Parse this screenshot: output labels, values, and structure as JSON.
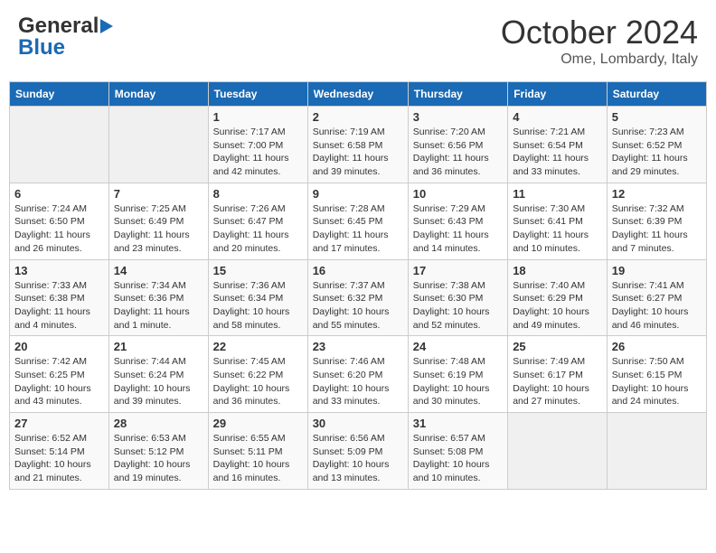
{
  "header": {
    "logo_line1": "General",
    "logo_line2": "Blue",
    "month": "October 2024",
    "location": "Ome, Lombardy, Italy"
  },
  "weekdays": [
    "Sunday",
    "Monday",
    "Tuesday",
    "Wednesday",
    "Thursday",
    "Friday",
    "Saturday"
  ],
  "weeks": [
    [
      {
        "day": "",
        "sunrise": "",
        "sunset": "",
        "daylight": ""
      },
      {
        "day": "",
        "sunrise": "",
        "sunset": "",
        "daylight": ""
      },
      {
        "day": "1",
        "sunrise": "Sunrise: 7:17 AM",
        "sunset": "Sunset: 7:00 PM",
        "daylight": "Daylight: 11 hours and 42 minutes."
      },
      {
        "day": "2",
        "sunrise": "Sunrise: 7:19 AM",
        "sunset": "Sunset: 6:58 PM",
        "daylight": "Daylight: 11 hours and 39 minutes."
      },
      {
        "day": "3",
        "sunrise": "Sunrise: 7:20 AM",
        "sunset": "Sunset: 6:56 PM",
        "daylight": "Daylight: 11 hours and 36 minutes."
      },
      {
        "day": "4",
        "sunrise": "Sunrise: 7:21 AM",
        "sunset": "Sunset: 6:54 PM",
        "daylight": "Daylight: 11 hours and 33 minutes."
      },
      {
        "day": "5",
        "sunrise": "Sunrise: 7:23 AM",
        "sunset": "Sunset: 6:52 PM",
        "daylight": "Daylight: 11 hours and 29 minutes."
      }
    ],
    [
      {
        "day": "6",
        "sunrise": "Sunrise: 7:24 AM",
        "sunset": "Sunset: 6:50 PM",
        "daylight": "Daylight: 11 hours and 26 minutes."
      },
      {
        "day": "7",
        "sunrise": "Sunrise: 7:25 AM",
        "sunset": "Sunset: 6:49 PM",
        "daylight": "Daylight: 11 hours and 23 minutes."
      },
      {
        "day": "8",
        "sunrise": "Sunrise: 7:26 AM",
        "sunset": "Sunset: 6:47 PM",
        "daylight": "Daylight: 11 hours and 20 minutes."
      },
      {
        "day": "9",
        "sunrise": "Sunrise: 7:28 AM",
        "sunset": "Sunset: 6:45 PM",
        "daylight": "Daylight: 11 hours and 17 minutes."
      },
      {
        "day": "10",
        "sunrise": "Sunrise: 7:29 AM",
        "sunset": "Sunset: 6:43 PM",
        "daylight": "Daylight: 11 hours and 14 minutes."
      },
      {
        "day": "11",
        "sunrise": "Sunrise: 7:30 AM",
        "sunset": "Sunset: 6:41 PM",
        "daylight": "Daylight: 11 hours and 10 minutes."
      },
      {
        "day": "12",
        "sunrise": "Sunrise: 7:32 AM",
        "sunset": "Sunset: 6:39 PM",
        "daylight": "Daylight: 11 hours and 7 minutes."
      }
    ],
    [
      {
        "day": "13",
        "sunrise": "Sunrise: 7:33 AM",
        "sunset": "Sunset: 6:38 PM",
        "daylight": "Daylight: 11 hours and 4 minutes."
      },
      {
        "day": "14",
        "sunrise": "Sunrise: 7:34 AM",
        "sunset": "Sunset: 6:36 PM",
        "daylight": "Daylight: 11 hours and 1 minute."
      },
      {
        "day": "15",
        "sunrise": "Sunrise: 7:36 AM",
        "sunset": "Sunset: 6:34 PM",
        "daylight": "Daylight: 10 hours and 58 minutes."
      },
      {
        "day": "16",
        "sunrise": "Sunrise: 7:37 AM",
        "sunset": "Sunset: 6:32 PM",
        "daylight": "Daylight: 10 hours and 55 minutes."
      },
      {
        "day": "17",
        "sunrise": "Sunrise: 7:38 AM",
        "sunset": "Sunset: 6:30 PM",
        "daylight": "Daylight: 10 hours and 52 minutes."
      },
      {
        "day": "18",
        "sunrise": "Sunrise: 7:40 AM",
        "sunset": "Sunset: 6:29 PM",
        "daylight": "Daylight: 10 hours and 49 minutes."
      },
      {
        "day": "19",
        "sunrise": "Sunrise: 7:41 AM",
        "sunset": "Sunset: 6:27 PM",
        "daylight": "Daylight: 10 hours and 46 minutes."
      }
    ],
    [
      {
        "day": "20",
        "sunrise": "Sunrise: 7:42 AM",
        "sunset": "Sunset: 6:25 PM",
        "daylight": "Daylight: 10 hours and 43 minutes."
      },
      {
        "day": "21",
        "sunrise": "Sunrise: 7:44 AM",
        "sunset": "Sunset: 6:24 PM",
        "daylight": "Daylight: 10 hours and 39 minutes."
      },
      {
        "day": "22",
        "sunrise": "Sunrise: 7:45 AM",
        "sunset": "Sunset: 6:22 PM",
        "daylight": "Daylight: 10 hours and 36 minutes."
      },
      {
        "day": "23",
        "sunrise": "Sunrise: 7:46 AM",
        "sunset": "Sunset: 6:20 PM",
        "daylight": "Daylight: 10 hours and 33 minutes."
      },
      {
        "day": "24",
        "sunrise": "Sunrise: 7:48 AM",
        "sunset": "Sunset: 6:19 PM",
        "daylight": "Daylight: 10 hours and 30 minutes."
      },
      {
        "day": "25",
        "sunrise": "Sunrise: 7:49 AM",
        "sunset": "Sunset: 6:17 PM",
        "daylight": "Daylight: 10 hours and 27 minutes."
      },
      {
        "day": "26",
        "sunrise": "Sunrise: 7:50 AM",
        "sunset": "Sunset: 6:15 PM",
        "daylight": "Daylight: 10 hours and 24 minutes."
      }
    ],
    [
      {
        "day": "27",
        "sunrise": "Sunrise: 6:52 AM",
        "sunset": "Sunset: 5:14 PM",
        "daylight": "Daylight: 10 hours and 21 minutes."
      },
      {
        "day": "28",
        "sunrise": "Sunrise: 6:53 AM",
        "sunset": "Sunset: 5:12 PM",
        "daylight": "Daylight: 10 hours and 19 minutes."
      },
      {
        "day": "29",
        "sunrise": "Sunrise: 6:55 AM",
        "sunset": "Sunset: 5:11 PM",
        "daylight": "Daylight: 10 hours and 16 minutes."
      },
      {
        "day": "30",
        "sunrise": "Sunrise: 6:56 AM",
        "sunset": "Sunset: 5:09 PM",
        "daylight": "Daylight: 10 hours and 13 minutes."
      },
      {
        "day": "31",
        "sunrise": "Sunrise: 6:57 AM",
        "sunset": "Sunset: 5:08 PM",
        "daylight": "Daylight: 10 hours and 10 minutes."
      },
      {
        "day": "",
        "sunrise": "",
        "sunset": "",
        "daylight": ""
      },
      {
        "day": "",
        "sunrise": "",
        "sunset": "",
        "daylight": ""
      }
    ]
  ]
}
